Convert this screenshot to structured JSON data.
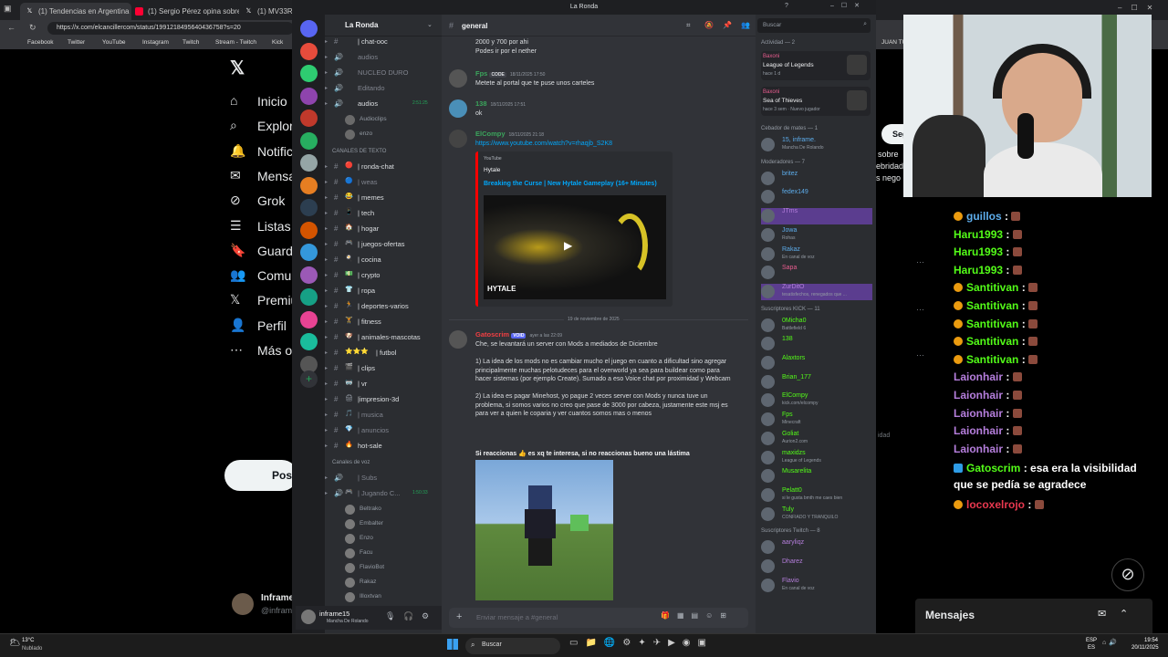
{
  "browser": {
    "tabs": [
      {
        "label": "(1) Tendencias en Argentina (@p",
        "icon": "x-icon",
        "color": "#ffffff"
      },
      {
        "label": "(1) Sergio Pérez opina sobre las ...",
        "icon": "youtube-icon",
        "color": "#ff0033"
      },
      {
        "label": "(1) MV33Racin",
        "icon": "x-icon",
        "color": "#ffffff"
      }
    ],
    "url": "https://x.com/elcancillercom/status/1991218495640436758?s=20",
    "bookmarks": [
      "Facebook",
      "Twitter",
      "YouTube",
      "Instagram",
      "Twitch",
      "Stream - Twitch",
      "Kick",
      "JUAN TU"
    ]
  },
  "xnav": {
    "items": [
      {
        "label": "Inicio",
        "icon": "home-icon",
        "glyph": "⌂"
      },
      {
        "label": "Explora",
        "icon": "search-icon",
        "glyph": "⌕"
      },
      {
        "label": "Notific",
        "icon": "bell-icon",
        "glyph": "🔔"
      },
      {
        "label": "Mensa",
        "icon": "mail-icon",
        "glyph": "✉"
      },
      {
        "label": "Grok",
        "icon": "grok-icon",
        "glyph": "⊘"
      },
      {
        "label": "Listas",
        "icon": "list-icon",
        "glyph": "☰"
      },
      {
        "label": "Guarda",
        "icon": "bookmark-icon",
        "glyph": "🔖"
      },
      {
        "label": "Comun",
        "icon": "communities-icon",
        "glyph": "👥"
      },
      {
        "label": "Premiu",
        "icon": "x-premium-icon",
        "glyph": "𝕏"
      },
      {
        "label": "Perfil",
        "icon": "profile-icon",
        "glyph": "👤"
      },
      {
        "label": "Más op",
        "icon": "more-icon",
        "glyph": "⋯"
      }
    ],
    "post_label": "Post",
    "account_name": "Inframe",
    "account_handle": "@infram",
    "right_fragments": [
      "Seg",
      "sobre",
      "ebridad",
      "s nego",
      "idad"
    ]
  },
  "discord": {
    "window_title": "La Ronda",
    "search_placeholder": "Buscar",
    "server_name": "La Ronda",
    "channel_name": "general",
    "channels_top": [
      {
        "name": "| chat-ooc",
        "emoji": "",
        "arrow": "▸"
      },
      {
        "name": "audios",
        "emoji": "",
        "dim": true,
        "voice": true
      },
      {
        "name": "NUCLEO DURO",
        "emoji": "",
        "dim": true,
        "voice": true
      },
      {
        "name": "Editando",
        "emoji": "",
        "dim": true,
        "voice": true
      },
      {
        "name": "audios",
        "emoji": "",
        "voice": true,
        "time": "2:51:25"
      }
    ],
    "voice_top_users": [
      "Audioclips",
      "enzo"
    ],
    "category_text": "CANALES DE TEXTO",
    "text_channels": [
      {
        "name": "| ronda-chat",
        "emoji": "🔴"
      },
      {
        "name": "| weas",
        "emoji": "🔵",
        "dim": true
      },
      {
        "name": "| memes",
        "emoji": "😂"
      },
      {
        "name": "| tech",
        "emoji": "📱"
      },
      {
        "name": "| hogar",
        "emoji": "🏠"
      },
      {
        "name": "| juegos-ofertas",
        "emoji": "🎮"
      },
      {
        "name": "| cocina",
        "emoji": "🍳"
      },
      {
        "name": "| crypto",
        "emoji": "💵"
      },
      {
        "name": "| ropa",
        "emoji": "👕"
      },
      {
        "name": "| deportes-varios",
        "emoji": "🏃"
      },
      {
        "name": "| fitness",
        "emoji": "🏋"
      },
      {
        "name": "| animales-mascotas",
        "emoji": "🐶"
      },
      {
        "name": "| futbol",
        "emoji": "⭐⭐⭐"
      },
      {
        "name": "| clips",
        "emoji": "🎬"
      },
      {
        "name": "| vr",
        "emoji": "🥽"
      },
      {
        "name": "|impresion-3d",
        "emoji": "🖨"
      },
      {
        "name": "| musica",
        "emoji": "🎵",
        "dim": true
      },
      {
        "name": "| anuncios",
        "emoji": "💎",
        "dim": true
      },
      {
        "name": "hot-sale",
        "emoji": "🔥"
      }
    ],
    "category_voice": "Canales de voz",
    "voice_channels": [
      {
        "name": "| Subs",
        "emoji": "",
        "dim": true
      },
      {
        "name": "| Jugando C...",
        "emoji": "🎮",
        "dim": true,
        "time": "1:50:33"
      }
    ],
    "voice_users": [
      "Beltrako",
      "Embalter",
      "Enzo",
      "Facu",
      "FlavioBot",
      "Rakaz",
      "Illoxtvan"
    ],
    "user": {
      "name": "inframe15",
      "status": "Mancha De Rolando"
    },
    "messages": [
      {
        "author": "",
        "time": "",
        "color": "#dbdee1",
        "text": "2000 y 700 por ahi\nPodes ir por el nether",
        "avatar": ""
      },
      {
        "author": "Fps",
        "tag": "CODE",
        "time": "18/11/2025 17:50",
        "color": "#3ba55c",
        "text": "Metete al portal que te puse unos carteles",
        "avatar": "#555"
      },
      {
        "author": "138",
        "time": "18/11/2025 17:51",
        "color": "#3ba55c",
        "text": "ok",
        "avatar": "#4a8fb8"
      },
      {
        "author": "ElCompy",
        "time": "18/11/2025 21:18",
        "color": "#3ba55c",
        "text": "",
        "link": "https://www.youtube.com/watch?v=rhaqjb_S2K8",
        "avatar": "#444"
      },
      {
        "author": "Gatoscrim",
        "tag": "VOID",
        "time": "ayer a las 22:09",
        "color": "#f23f43",
        "text": "Che, se levantará un server con Mods a mediados de Diciembre\n\n1) La idea de los mods no es cambiar mucho el juego en cuanto a dificultad sino agregar principalmente muchas pelotudeces para el overworld ya sea para buildear como para hacer sistemas (por ejemplo Create). Sumado a eso Voice chat por proximidad y Webcam\n\n2) La idea es pagar Minehost, yo pague 2 veces server con Mods y nunca tuve un problema, si somos varios no creo que pase de 3000 por cabeza, justamente este msj es para ver a quien le coparia y ver cuantos somos mas o menos",
        "avatar": "#555"
      }
    ],
    "embed": {
      "provider": "YouTube",
      "author": "Hytale",
      "title": "Breaking the Curse | New Hytale Gameplay (16+ Minutes)",
      "brand": "HYTALE"
    },
    "date_divider": "19 de noviembre de 2025",
    "bold_line": "Si reaccionas 👍 es xq te interesa, si no reaccionas bueno una lástima",
    "composer_placeholder": "Enviar mensaje a #general",
    "members": {
      "activity_header": "Actividad — 2",
      "activities": [
        {
          "user": "Baxoni",
          "game": "League of Legends",
          "sub": "hace 1 d"
        },
        {
          "user": "Baxoni",
          "game": "Sea of Thieves",
          "sub": "hace 3 sem · Nuevo jugador"
        }
      ],
      "groups": [
        {
          "header": "Cebador de mates — 1",
          "members": [
            {
              "name": "15, inframe.",
              "status": "Mancha De Rolando",
              "color": "#5dadec"
            }
          ]
        },
        {
          "header": "Moderadores — 7",
          "members": [
            {
              "name": "britez",
              "status": "",
              "color": "#5dadec"
            },
            {
              "name": "fedex149",
              "status": "",
              "color": "#5dadec"
            },
            {
              "name": "JTms",
              "status": "",
              "color": "#b57edc"
            },
            {
              "name": "Jowa",
              "status": "Rohas",
              "color": "#5dadec"
            },
            {
              "name": "Rakaz",
              "status": "En canal de voz",
              "color": "#5dadec"
            },
            {
              "name": "Sapa",
              "status": "",
              "color": "#e85d8f"
            },
            {
              "name": "ZurDitO",
              "status": "tesatisfechos, renegados que ...",
              "color": "#b57edc"
            }
          ]
        },
        {
          "header": "Suscriptores KICK — 11",
          "members": [
            {
              "name": "0Micha0",
              "status": "Battlefield 6",
              "color": "#53fc18"
            },
            {
              "name": "138",
              "status": "",
              "color": "#53fc18"
            },
            {
              "name": "Alaxtors",
              "status": "",
              "color": "#53fc18"
            },
            {
              "name": "Brian_177",
              "status": "",
              "color": "#53fc18"
            },
            {
              "name": "ElCompy",
              "status": "kick.com/elcompy",
              "color": "#53fc18"
            },
            {
              "name": "Fps",
              "status": "Minecraft",
              "color": "#53fc18"
            },
            {
              "name": "Goliat",
              "status": "Aurion2.com",
              "color": "#53fc18"
            },
            {
              "name": "maxidzs",
              "status": "League of Legends",
              "color": "#53fc18"
            },
            {
              "name": "Musarelita",
              "status": "",
              "color": "#53fc18"
            },
            {
              "name": "Pelatt0",
              "status": "si le gusta bmth me caes bien",
              "color": "#53fc18"
            },
            {
              "name": "Tuly",
              "status": "CONFIADO Y TRANQUILO",
              "color": "#53fc18"
            }
          ]
        },
        {
          "header": "Suscriptores Twitch — 8",
          "members": [
            {
              "name": "aaryliqz",
              "status": "",
              "color": "#b57edc"
            },
            {
              "name": "Dharez",
              "status": "",
              "color": "#b57edc"
            },
            {
              "name": "Flavio",
              "status": "En canal de voz",
              "color": "#b57edc"
            }
          ]
        }
      ]
    }
  },
  "twitch_chat": {
    "lines": [
      {
        "user": "guillos",
        "color": "#5dadec",
        "badge": true,
        "emote": true,
        "text": ""
      },
      {
        "user": "Haru1993",
        "color": "#53fc18",
        "emote": true,
        "text": ""
      },
      {
        "user": "Haru1993",
        "color": "#53fc18",
        "emote": true,
        "text": ""
      },
      {
        "user": "Haru1993",
        "color": "#53fc18",
        "emote": true,
        "text": ""
      },
      {
        "user": "Santitivan",
        "color": "#53fc18",
        "badge": true,
        "emote": true,
        "text": ""
      },
      {
        "user": "Santitivan",
        "color": "#53fc18",
        "badge": true,
        "emote": true,
        "text": ""
      },
      {
        "user": "Santitivan",
        "color": "#53fc18",
        "badge": true,
        "emote": true,
        "text": ""
      },
      {
        "user": "Santitivan",
        "color": "#53fc18",
        "badge": true,
        "emote": true,
        "text": ""
      },
      {
        "user": "Santitivan",
        "color": "#53fc18",
        "badge": true,
        "emote": true,
        "text": ""
      },
      {
        "user": "Laionhair",
        "color": "#b57edc",
        "emote": true,
        "text": ""
      },
      {
        "user": "Laionhair",
        "color": "#b57edc",
        "emote": true,
        "text": ""
      },
      {
        "user": "Laionhair",
        "color": "#b57edc",
        "emote": true,
        "text": ""
      },
      {
        "user": "Laionhair",
        "color": "#b57edc",
        "emote": true,
        "text": ""
      },
      {
        "user": "Laionhair",
        "color": "#b57edc",
        "emote": true,
        "text": ""
      },
      {
        "user": "Gatoscrim",
        "color": "#53fc18",
        "text": "esa era la visibilidad que se pedía se agradece"
      },
      {
        "user": "locoxelrojo",
        "color": "#e8384f",
        "badge": true,
        "emote": true,
        "text": ""
      }
    ],
    "panel_title": "Mensajes"
  },
  "taskbar": {
    "weather_temp": "13°C",
    "weather_desc": "Nublado",
    "search": "Buscar",
    "lang": "ESP",
    "lang2": "ES",
    "time": "19:54",
    "date": "20/11/2025"
  }
}
